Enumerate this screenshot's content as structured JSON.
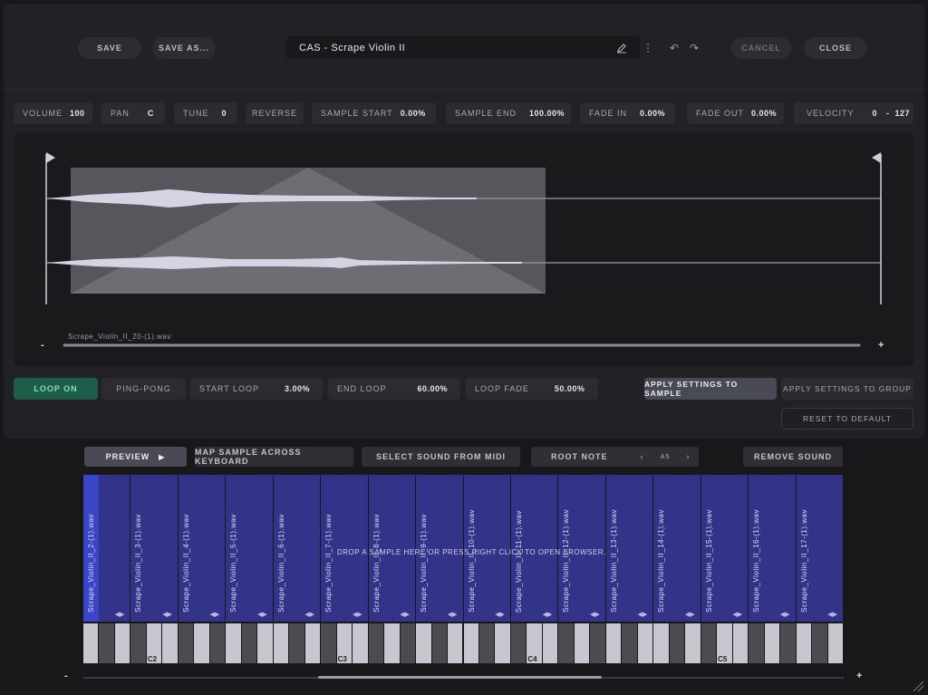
{
  "header": {
    "save_label": "SAVE",
    "save_as_label": "SAVE AS...",
    "title": "CAS - Scrape Violin II",
    "cancel_label": "CANCEL",
    "close_label": "CLOSE"
  },
  "params": {
    "volume_label": "VOLUME",
    "volume_value": "100",
    "pan_label": "PAN",
    "pan_value": "C",
    "tune_label": "TUNE",
    "tune_value": "0",
    "reverse_label": "REVERSE",
    "sample_start_label": "SAMPLE START",
    "sample_start_value": "0.00%",
    "sample_end_label": "SAMPLE END",
    "sample_end_value": "100.00%",
    "fade_in_label": "FADE IN",
    "fade_in_value": "0.00%",
    "fade_out_label": "FADE OUT",
    "fade_out_value": "0.00%",
    "velocity_label": "VELOCITY",
    "velocity_min": "0",
    "velocity_sep": "-",
    "velocity_max": "127"
  },
  "waveform": {
    "filename": "Scrape_Violin_II_20-(1).wav",
    "zoom_minus": "-",
    "zoom_plus": "+"
  },
  "loop": {
    "loop_on_label": "LOOP ON",
    "ping_pong_label": "PING-PONG",
    "start_loop_label": "START LOOP",
    "start_loop_value": "3.00%",
    "end_loop_label": "END LOOP",
    "end_loop_value": "60.00%",
    "loop_fade_label": "LOOP FADE",
    "loop_fade_value": "50.00%",
    "apply_sample_label": "APPLY SETTINGS TO SAMPLE",
    "apply_group_label": "APPLY SETTINGS TO GROUP",
    "reset_label": "RESET TO DEFAULT"
  },
  "mapping": {
    "preview_label": "PREVIEW",
    "map_label": "MAP SAMPLE ACROSS KEYBOARD",
    "select_midi_label": "SELECT SOUND FROM MIDI",
    "root_note_label": "ROOT NOTE",
    "root_note_value": "A5",
    "remove_label": "REMOVE SOUND",
    "drop_hint": "DROP A SAMPLE HERE OR PRESS RIGHT CLICK TO OPEN BROWSER.",
    "zones": [
      "Scrape_Violin_II_2-(1).wav",
      "Scrape_Violin_II_3-(1).wav",
      "Scrape_Violin_II_4-(1).wav",
      "Scrape_Violin_II_5-(1).wav",
      "Scrape_Violin_II_6-(1).wav",
      "Scrape_Violin_II_7-(1).wav",
      "Scrape_Violin_II_8-(1).wav",
      "Scrape_Violin_II_9-(1).wav",
      "Scrape_Violin_II_10-(1).wav",
      "Scrape_Violin_II_11-(1).wav",
      "Scrape_Violin_II_12-(1).wav",
      "Scrape_Violin_II_13-(1).wav",
      "Scrape_Violin_II_14-(1).wav",
      "Scrape_Violin_II_15-(1).wav",
      "Scrape_Violin_II_16-(1).wav",
      "Scrape_Violin_II_17-(1).wav"
    ],
    "octaves": [
      "C2",
      "C3",
      "C4",
      "C5"
    ],
    "zoom_minus": "-",
    "zoom_plus": "+"
  },
  "colors": {
    "loop_on": "#1f5c4a",
    "zone_fill": "#33338a",
    "zone_selected": "#3a45c8",
    "apply_active": "#4a4a55"
  }
}
